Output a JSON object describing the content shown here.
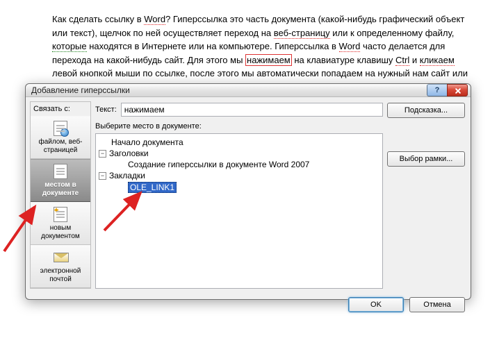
{
  "background_paragraph": {
    "t1": "Как сделать ссылку в ",
    "word1": "Word",
    "t2": "? Гиперссылка это часть документа (какой-нибудь графический объект или текст), щелчок по ней осуществляет переход на ",
    "web": "веб-страницу",
    "t3": " или к определенному файлу, ",
    "kot": "которые",
    "t4": " находятся в Интернете или на компьютере. Гиперссылка в ",
    "word2": "Word",
    "t5": " часто делается  для перехода на какой-нибудь сайт. Для этого мы ",
    "sel": "нажимаем",
    "t6": " на клавиатуре клавишу ",
    "ctrl": "Ctrl",
    "t7": " и ",
    "klik": "кликаем",
    "t8": " левой кнопкой мыши по ссылке, после этого мы автоматически попадаем на нужный нам сайт или"
  },
  "dialog": {
    "title": "Добавление гиперссылки",
    "help_label": "?",
    "link_to_label": "Связать с:",
    "text_label": "Текст:",
    "text_value": "нажимаем",
    "screentip_btn": "Подсказка...",
    "frame_btn": "Выбор рамки...",
    "section_label": "Выберите место в документе:",
    "tree": {
      "root1": "Начало документа",
      "root2": "Заголовки",
      "child2a": "Создание гиперссылки в документе Word 2007",
      "root3": "Закладки",
      "child3a": "OLE_LINK1",
      "toggle_minus": "−"
    },
    "linkto": {
      "item1": "файлом, веб-страницей",
      "item2": "местом в документе",
      "item3": "новым документом",
      "item4": "электронной почтой"
    },
    "ok": "OK",
    "cancel": "Отмена"
  }
}
